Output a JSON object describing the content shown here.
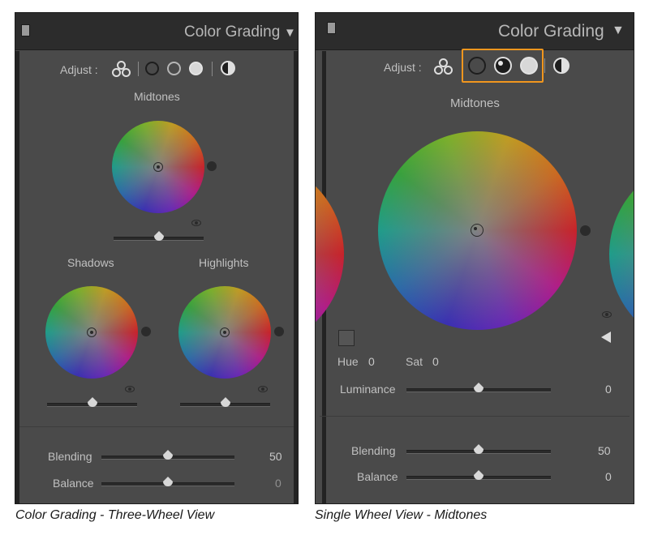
{
  "panel_left": {
    "header_title": "Color Grading",
    "adjust_label": "Adjust :",
    "midtones_label": "Midtones",
    "shadows_label": "Shadows",
    "highlights_label": "Highlights",
    "blending_label": "Blending",
    "blending_value": "50",
    "balance_label": "Balance",
    "balance_value": "0"
  },
  "panel_right": {
    "header_title": "Color Grading",
    "adjust_label": "Adjust :",
    "midtones_label": "Midtones",
    "hue_label": "Hue",
    "hue_value": "0",
    "sat_label": "Sat",
    "sat_value": "0",
    "luminance_label": "Luminance",
    "luminance_value": "0",
    "blending_label": "Blending",
    "blending_value": "50",
    "balance_label": "Balance",
    "balance_value": "0"
  },
  "captions": {
    "left": "Color Grading - Three-Wheel View",
    "right": "Single Wheel View - Midtones"
  },
  "sliders": {
    "blending_fraction": 0.5,
    "balance_fraction": 0.5,
    "luminance_fraction": 0.5
  },
  "icons": {
    "header_square": "panel-square-icon",
    "collapse": "triangle-down-icon",
    "three_wheel": "three-circles-icon",
    "global": "half-circle-icon",
    "eye": "eye-icon",
    "back": "triangle-left-icon"
  },
  "colors": {
    "panel_bg": "#4a4a4a",
    "header_bg": "#2c2c2c",
    "highlight_box": "#f0961e"
  }
}
